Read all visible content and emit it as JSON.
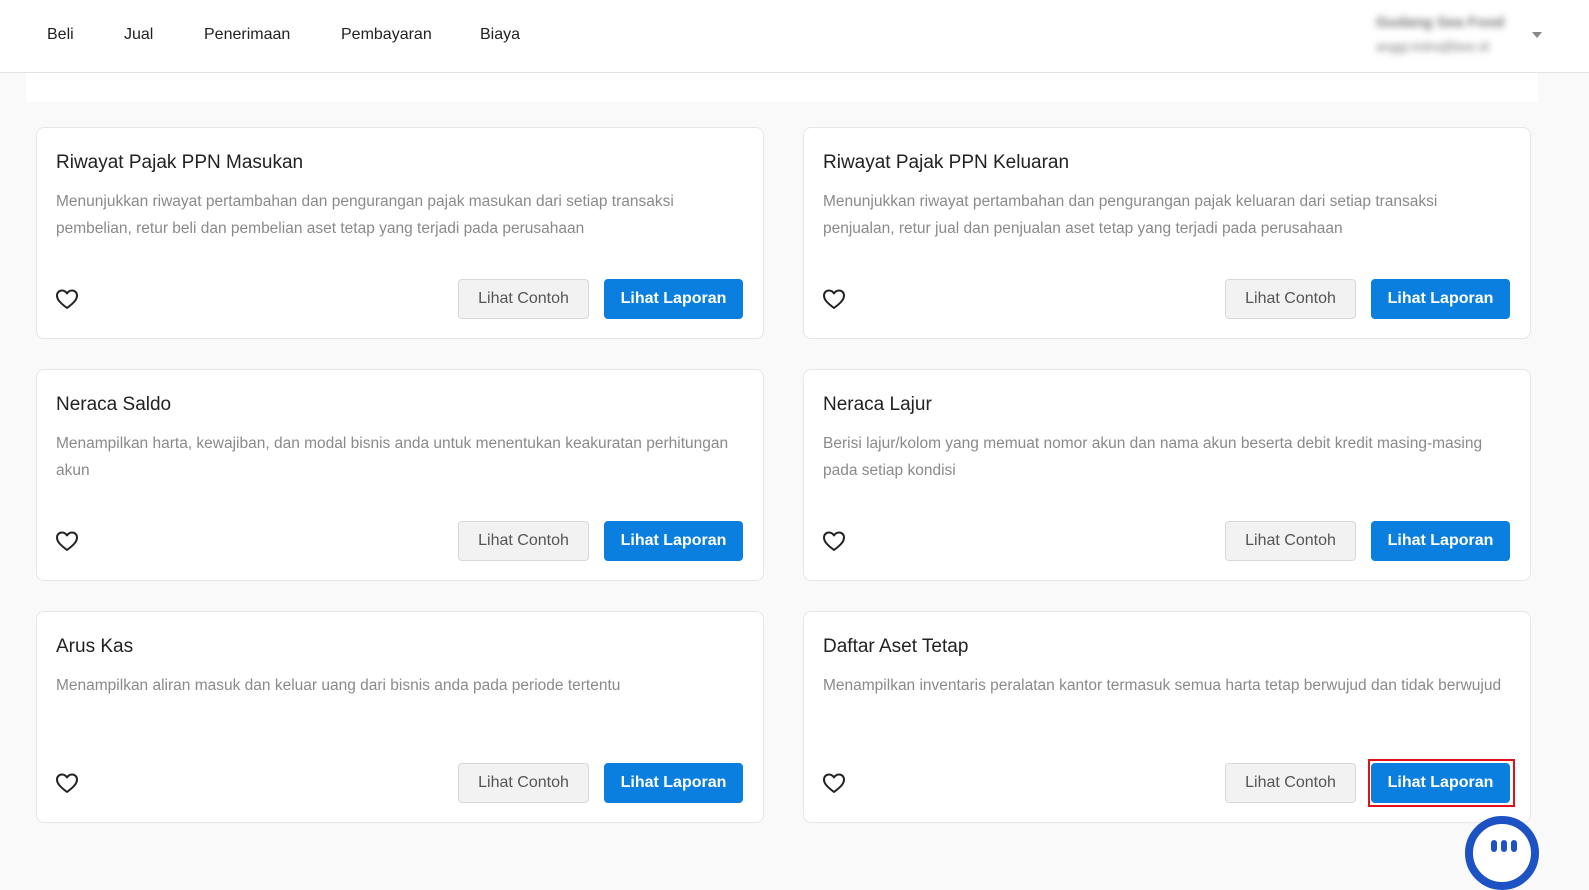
{
  "nav": {
    "items": [
      "Beli",
      "Jual",
      "Penerimaan",
      "Pembayaran",
      "Biaya"
    ]
  },
  "account": {
    "name": "Gudang Sea Food",
    "email": "anggi.indra@bee.id"
  },
  "cards": [
    {
      "title": "Riwayat Pajak PPN Masukan",
      "description": "Menunjukkan riwayat pertambahan dan pengurangan pajak masukan dari setiap transaksi pembelian, retur beli dan pembelian aset tetap yang terjadi pada perusahaan",
      "secondary_label": "Lihat Contoh",
      "primary_label": "Lihat Laporan"
    },
    {
      "title": "Riwayat Pajak PPN Keluaran",
      "description": "Menunjukkan riwayat pertambahan dan pengurangan pajak keluaran dari setiap transaksi penjualan, retur jual dan penjualan aset tetap yang terjadi pada perusahaan",
      "secondary_label": "Lihat Contoh",
      "primary_label": "Lihat Laporan"
    },
    {
      "title": "Neraca Saldo",
      "description": "Menampilkan harta, kewajiban, dan modal bisnis anda untuk menentukan keakuratan perhitungan akun",
      "secondary_label": "Lihat Contoh",
      "primary_label": "Lihat Laporan"
    },
    {
      "title": "Neraca Lajur",
      "description": "Berisi lajur/kolom yang memuat nomor akun dan nama akun beserta debit kredit masing-masing pada setiap kondisi",
      "secondary_label": "Lihat Contoh",
      "primary_label": "Lihat Laporan"
    },
    {
      "title": "Arus Kas",
      "description": "Menampilkan aliran masuk dan keluar uang dari bisnis anda pada periode tertentu",
      "secondary_label": "Lihat Contoh",
      "primary_label": "Lihat Laporan"
    },
    {
      "title": "Daftar Aset Tetap",
      "description": "Menampilkan inventaris peralatan kantor termasuk semua harta tetap berwujud dan tidak berwujud",
      "secondary_label": "Lihat Contoh",
      "primary_label": "Lihat Laporan"
    }
  ],
  "colors": {
    "primary": "#0a7fe0",
    "highlight": "#e0121a",
    "chat": "#1d52c4"
  },
  "icons": {
    "favorite": "heart-outline-icon",
    "account_menu": "caret-down-icon",
    "chat": "chat-icon"
  }
}
